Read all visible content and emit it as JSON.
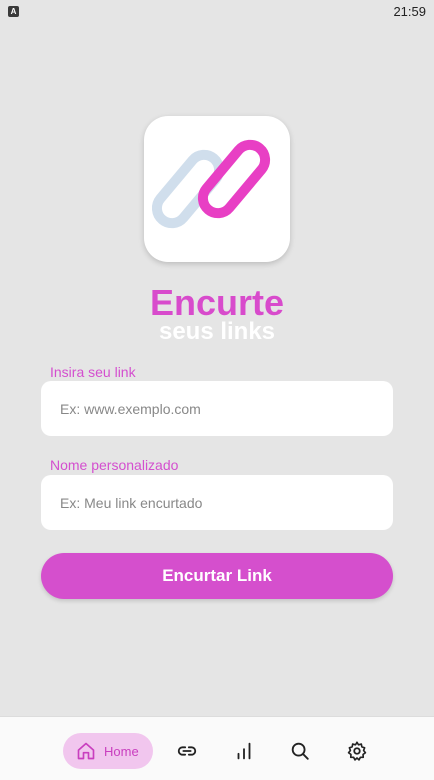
{
  "status_bar": {
    "time": "21:59",
    "app_icon_letter": "A"
  },
  "hero": {
    "title": "Encurte",
    "subtitle": "seus links"
  },
  "form": {
    "link_label": "Insira seu link",
    "link_placeholder": "Ex: www.exemplo.com",
    "name_label": "Nome personalizado",
    "name_placeholder": "Ex: Meu link encurtado",
    "submit_label": "Encurtar Link"
  },
  "nav": {
    "home_label": "Home",
    "items": [
      "home-icon",
      "link-icon",
      "stats-icon",
      "search-icon",
      "settings-icon"
    ]
  },
  "colors": {
    "accent": "#d54fcd",
    "background": "#e5e5e5",
    "home_pill": "#f1c6ee",
    "logo_link_pink": "#e83fc4",
    "logo_link_blue": "#d0deec"
  }
}
